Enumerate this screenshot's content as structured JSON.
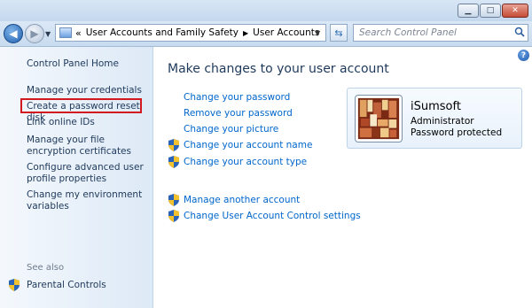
{
  "navigation": {
    "breadcrumb": [
      "User Accounts and Family Safety",
      "User Accounts"
    ],
    "search_placeholder": "Search Control Panel"
  },
  "left_pane": {
    "home_link": "Control Panel Home",
    "tasks": [
      "Manage your credentials",
      "Create a password reset disk",
      "Link online IDs",
      "Manage your file encryption certificates",
      "Configure advanced user profile properties",
      "Change my environment variables"
    ],
    "see_also_label": "See also",
    "see_also_items": [
      "Parental Controls"
    ]
  },
  "main": {
    "title": "Make changes to your user account",
    "account_links": [
      "Change your password",
      "Remove your password",
      "Change your picture",
      "Change your account name",
      "Change your account type"
    ],
    "other_links": [
      "Manage another account",
      "Change User Account Control settings"
    ]
  },
  "account": {
    "name": "iSumsoft",
    "role": "Administrator",
    "status": "Password protected"
  },
  "colors": {
    "link": "#0066cc",
    "highlight_border": "#d1191f",
    "title_text": "#1e395b"
  }
}
